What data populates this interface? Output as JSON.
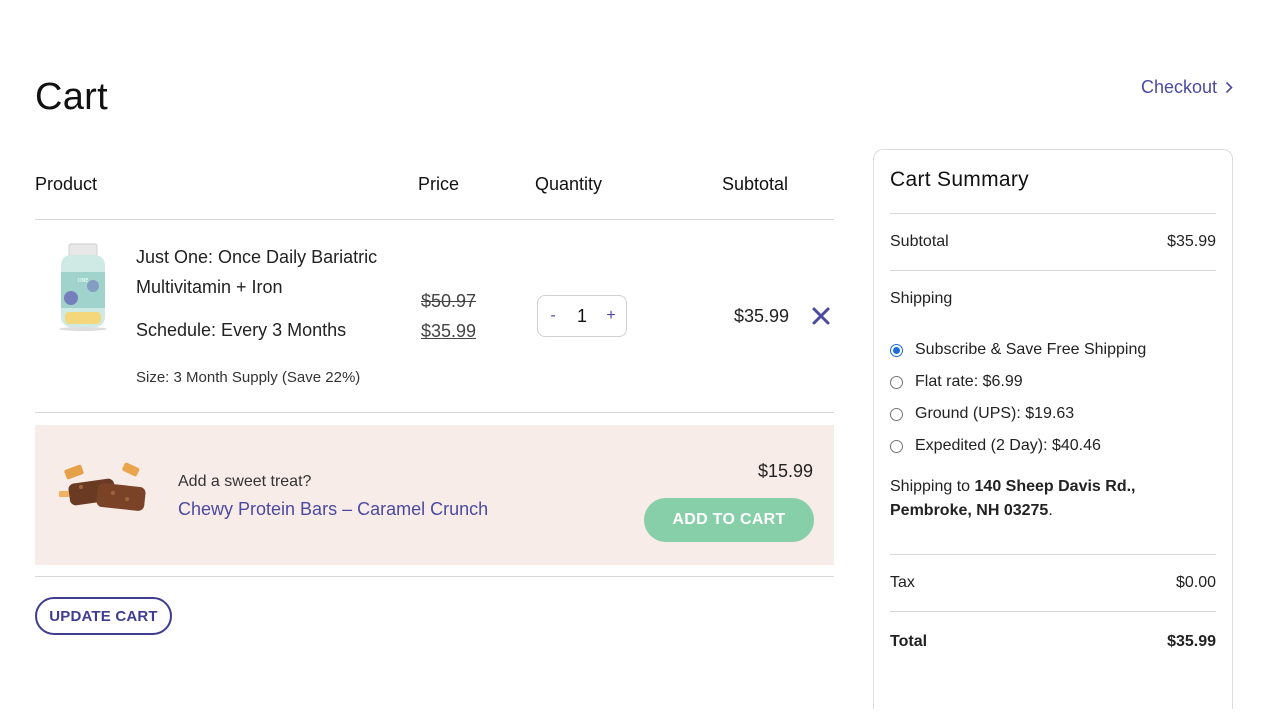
{
  "page": {
    "title": "Cart",
    "checkout_label": "Checkout",
    "checkout_icon": "chevron-right-icon"
  },
  "table": {
    "headers": {
      "product": "Product",
      "price": "Price",
      "quantity": "Quantity",
      "subtotal": "Subtotal"
    },
    "items": [
      {
        "name": "Just One: Once Daily Bariatric Multivitamin + Iron",
        "schedule": "Schedule: Every 3 Months",
        "size": "Size:  3 Month Supply (Save 22%)",
        "price_original": "$50.97",
        "price_current": "$35.99",
        "quantity": "1",
        "qty_minus": "-",
        "qty_plus": "+",
        "subtotal": "$35.99",
        "remove_icon": "close-icon"
      }
    ]
  },
  "upsell": {
    "prompt": "Add a sweet treat?",
    "product_name": "Chewy Protein Bars – Caramel Crunch",
    "price": "$15.99",
    "add_button": "ADD TO CART"
  },
  "update_cart_label": "UPDATE CART",
  "summary": {
    "title": "Cart Summary",
    "subtotal_label": "Subtotal",
    "subtotal_value": "$35.99",
    "shipping_label": "Shipping",
    "shipping_options": [
      {
        "label": "Subscribe & Save Free Shipping",
        "selected": true
      },
      {
        "label": "Flat rate: $6.99",
        "selected": false
      },
      {
        "label": "Ground (UPS): $19.63",
        "selected": false
      },
      {
        "label": "Expedited (2 Day): $40.46",
        "selected": false
      }
    ],
    "ship_to_prefix": "Shipping to",
    "ship_to_address": "140 Sheep Davis Rd., Pembroke, NH 03275",
    "ship_to_suffix": ".",
    "tax_label": "Tax",
    "tax_value": "$0.00",
    "total_label": "Total",
    "total_value": "$35.99"
  },
  "colors": {
    "accent": "#4b4aa0",
    "upsell_bg": "#f7ece8",
    "add_button": "#86cfa8",
    "radio_selected": "#1a6ed8"
  }
}
